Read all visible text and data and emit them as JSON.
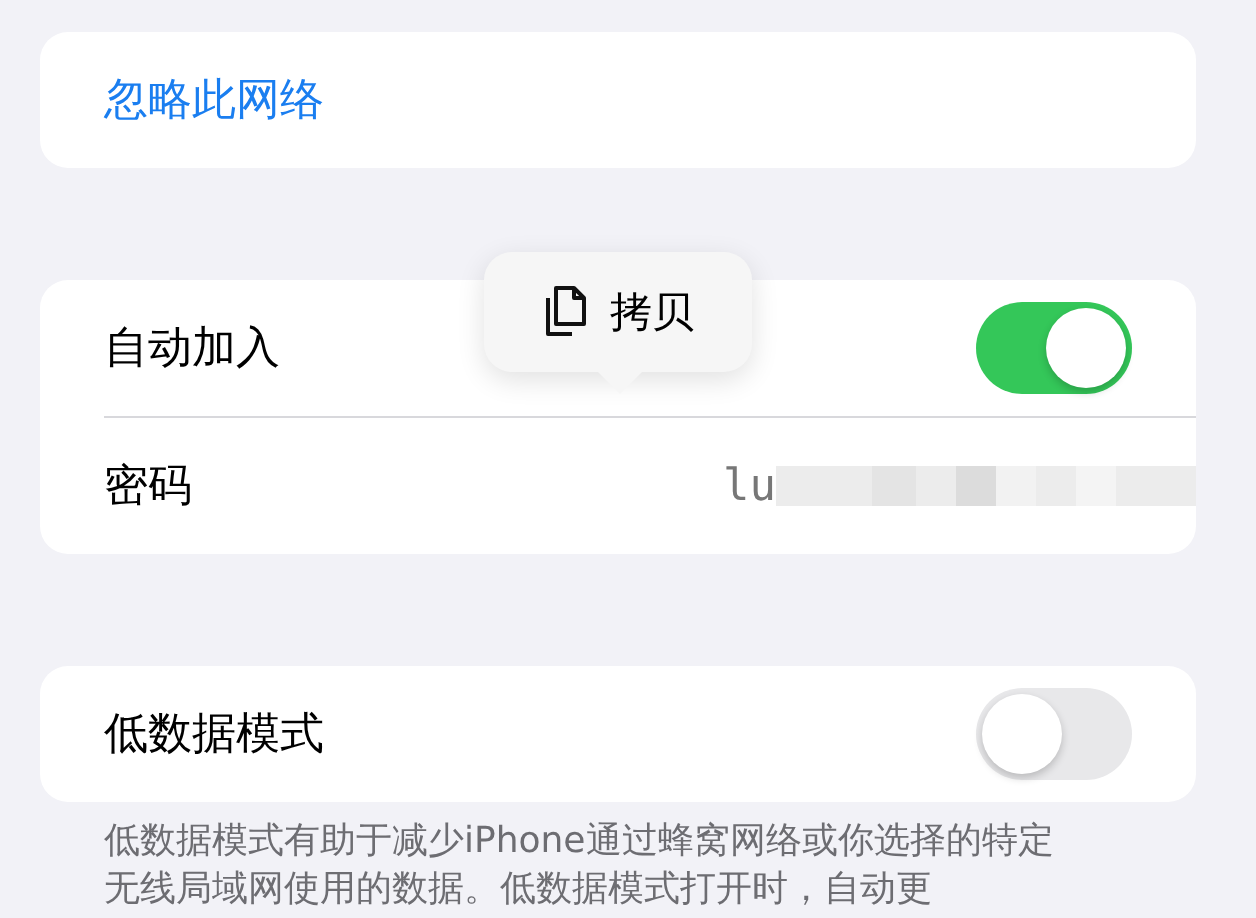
{
  "forget_network": {
    "label": "忽略此网络"
  },
  "settings": [
    {
      "kind": "toggle",
      "label": "自动加入",
      "on": true
    },
    {
      "kind": "password",
      "label": "密码",
      "value": "lu"
    }
  ],
  "copy_popup": {
    "label": "拷贝"
  },
  "low_data": {
    "label": "低数据模式",
    "on": false
  },
  "footer": "低数据模式有助于减少iPhone通过蜂窝网络或你选择的特定无线局域网使用的数据。低数据模式打开时，自动更"
}
